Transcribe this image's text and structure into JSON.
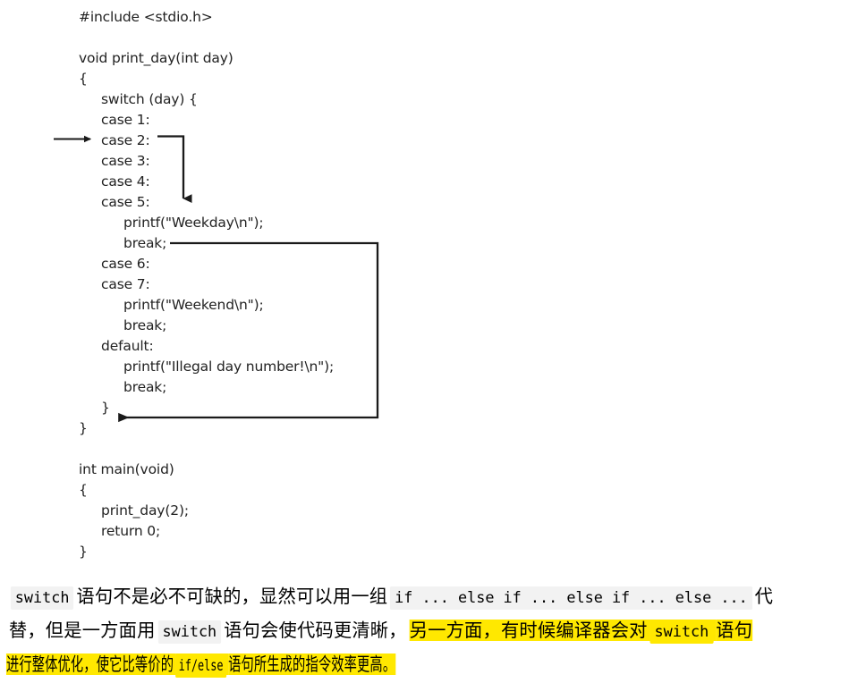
{
  "code": {
    "language": "c",
    "font_color": "#222222",
    "lines": [
      {
        "indent": 0,
        "text": "#include <stdio.h>"
      },
      {
        "indent": 0,
        "text": ""
      },
      {
        "indent": 0,
        "text": "void print_day(int day)"
      },
      {
        "indent": 0,
        "text": "{"
      },
      {
        "indent": 1,
        "text": "switch (day) {"
      },
      {
        "indent": 1,
        "text": "case 1:"
      },
      {
        "indent": 1,
        "text": "case 2:"
      },
      {
        "indent": 1,
        "text": "case 3:"
      },
      {
        "indent": 1,
        "text": "case 4:"
      },
      {
        "indent": 1,
        "text": "case 5:"
      },
      {
        "indent": 2,
        "text": "printf(\"Weekday\\n\");"
      },
      {
        "indent": 2,
        "text": "break;"
      },
      {
        "indent": 1,
        "text": "case 6:"
      },
      {
        "indent": 1,
        "text": "case 7:"
      },
      {
        "indent": 2,
        "text": "printf(\"Weekend\\n\");"
      },
      {
        "indent": 2,
        "text": "break;"
      },
      {
        "indent": 1,
        "text": "default:"
      },
      {
        "indent": 2,
        "text": "printf(\"Illegal day number!\\n\");"
      },
      {
        "indent": 2,
        "text": "break;"
      },
      {
        "indent": 1,
        "text": "}"
      },
      {
        "indent": 0,
        "text": "}"
      },
      {
        "indent": 0,
        "text": ""
      },
      {
        "indent": 0,
        "text": "int main(void)"
      },
      {
        "indent": 0,
        "text": "{"
      },
      {
        "indent": 1,
        "text": "print_day(2);"
      },
      {
        "indent": 1,
        "text": "return 0;"
      },
      {
        "indent": 0,
        "text": "}"
      }
    ]
  },
  "annotations": {
    "stroke_color": "#1a1a1a",
    "entry_arrow": {
      "name": "entry-arrow-to-case-2",
      "description": "arrow pointing at case 2 label"
    },
    "jump_arrow": {
      "name": "jump-arrow-case2-to-printf",
      "description": "arrow from case 2 down to printf(\"Weekday\\n\")"
    },
    "break_arrow": {
      "name": "break-arrow-to-switch-end",
      "description": "arrow from break; around to closing brace of switch"
    }
  },
  "paragraph": {
    "highlight_color": "#ffe800",
    "code_bg_color": "#f2f2f2",
    "lines": [
      {
        "id": "line-1",
        "segments": [
          {
            "type": "code",
            "text": "switch",
            "highlight": false
          },
          {
            "type": "zh",
            "text": "语句不是必不可缺的，显然可以用一组",
            "highlight": false
          },
          {
            "type": "code",
            "text": "if ... else if ... else if ... else ...",
            "highlight": false
          },
          {
            "type": "zh",
            "text": "代",
            "highlight": false
          }
        ]
      },
      {
        "id": "line-2",
        "segments": [
          {
            "type": "zh",
            "text": "替，但是一方面用",
            "highlight": false
          },
          {
            "type": "code",
            "text": "switch",
            "highlight": false
          },
          {
            "type": "zh",
            "text": "语句会使代码更清晰，",
            "highlight": false
          },
          {
            "type": "zh",
            "text": "另一方面，有时候编译器会对",
            "highlight": true
          },
          {
            "type": "code",
            "text": "switch",
            "highlight": true
          },
          {
            "type": "zh",
            "text": "语句",
            "highlight": true
          }
        ]
      },
      {
        "id": "line-3",
        "segments": [
          {
            "type": "zh",
            "text": "进行整体优化，使它比等价的",
            "highlight": true
          },
          {
            "type": "code",
            "text": "if/else",
            "highlight": true
          },
          {
            "type": "zh",
            "text": "语句所生成的指令效率更高。",
            "highlight": true
          }
        ]
      }
    ]
  }
}
